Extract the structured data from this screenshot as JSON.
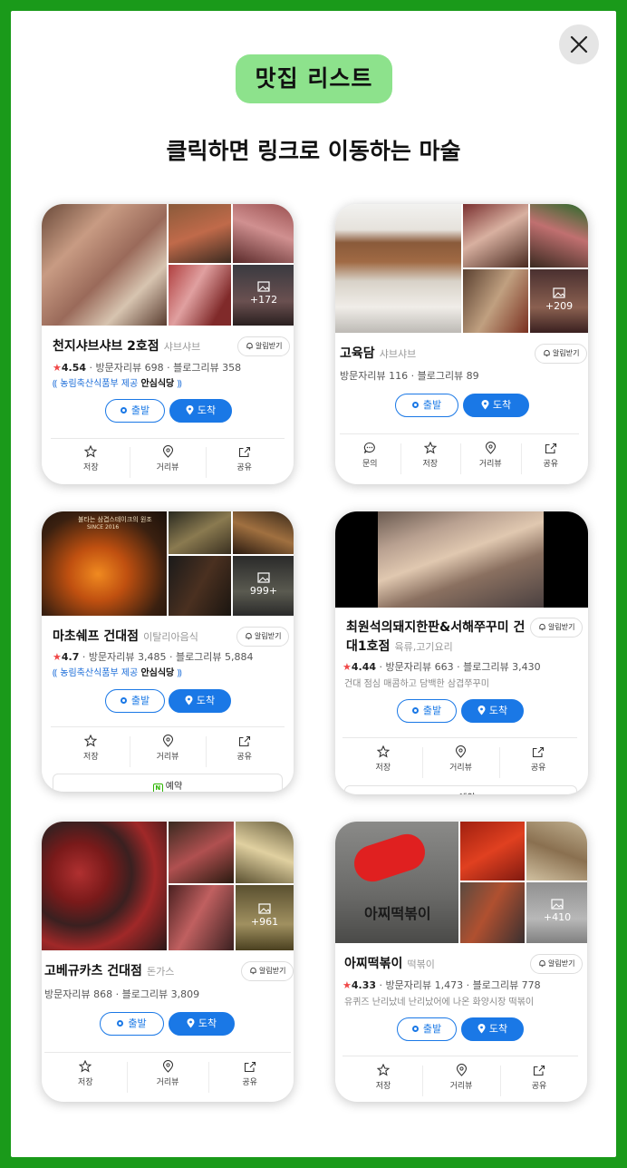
{
  "header": {
    "title": "맛집 리스트",
    "subtitle": "클릭하면 링크로 이동하는 마술"
  },
  "actions": {
    "depart": "출발",
    "arrive": "도착",
    "save": "저장",
    "distance": "거리뷰",
    "share": "공유",
    "inquiry": "문의",
    "notify": "알림받기",
    "reserve": "예약"
  },
  "cards": [
    {
      "name": "천지샤브샤브 2호점",
      "category": "샤브샤브",
      "rating": "4.54",
      "stats": "· 방문자리뷰 698 · 블로그리뷰 358",
      "safe_label": "농림축산식품부 제공",
      "safe_badge": "안심식당",
      "photo_count": "+172"
    },
    {
      "name": "고육담",
      "category": "샤브샤브",
      "stats": "방문자리뷰 116 · 블로그리뷰 89",
      "photo_count": "+209"
    },
    {
      "name": "마초쉐프 건대점",
      "category": "이탈리아음식",
      "rating": "4.7",
      "stats": "· 방문자리뷰 3,485 · 블로그리뷰 5,884",
      "safe_label": "농림축산식품부 제공",
      "safe_badge": "안심식당",
      "photo_count": "999+",
      "photo_caption": "불타는 삼겹스테이크의 원조",
      "photo_caption2": "SINCE 2016"
    },
    {
      "name_line1": "최원석의돼지한판&서해쭈꾸미 건",
      "name_line2": "대1호점",
      "category": "육류,고기요리",
      "rating": "4.44",
      "stats": "· 방문자리뷰 663 · 블로그리뷰 3,430",
      "desc": "건대 점심 매콤하고 담백한 삼겹쭈꾸미"
    },
    {
      "name": "고베규카츠 건대점",
      "category": "돈가스",
      "stats": "방문자리뷰 868 · 블로그리뷰 3,809",
      "photo_count": "+961"
    },
    {
      "name": "아찌떡볶이",
      "category": "떡볶이",
      "rating": "4.33",
      "stats": "· 방문자리뷰 1,473 · 블로그리뷰 778",
      "desc": "유퀴즈 난리났네 난리났어에 나온 화양시장 떡볶이",
      "photo_count": "+410",
      "sign_text": "아찌떡볶이"
    }
  ],
  "colors": {
    "frame_green": "#1a9a1a",
    "title_pill": "#8de28c",
    "primary_blue": "#1a78e6",
    "star_red": "#f04848"
  }
}
